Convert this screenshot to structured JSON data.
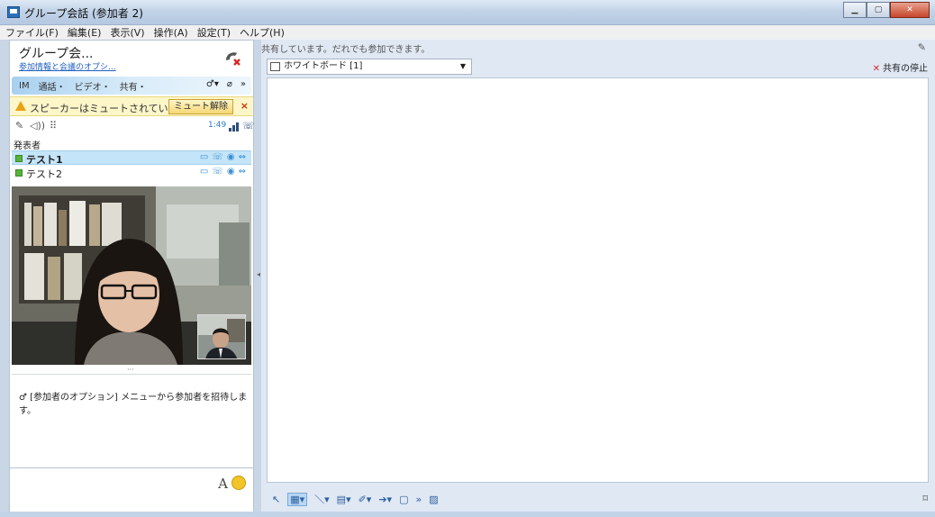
{
  "window": {
    "title": "グループ会話 (参加者 2)"
  },
  "menu": [
    "ファイル(F)",
    "編集(E)",
    "表示(V)",
    "操作(A)",
    "設定(T)",
    "ヘルプ(H)"
  ],
  "conversation": {
    "title": "グループ会...",
    "link": "参加情報と会議のオプシ..."
  },
  "modes": [
    "IM",
    "通話・",
    "ビデオ・",
    "共有・"
  ],
  "mute_banner": {
    "text": "スピーカーはミュートされていま...",
    "button": "ミュート解除",
    "close": "×"
  },
  "call": {
    "time": "1:49"
  },
  "participants": {
    "section": "発表者",
    "list": [
      {
        "name": "テスト1",
        "selected": true
      },
      {
        "name": "テスト2",
        "selected": false
      }
    ]
  },
  "notice": "[参加者のオプション] メニューから参加者を招待します。",
  "input": {
    "font_label": "A"
  },
  "share": {
    "status": "共有しています。だれでも参加できます。",
    "whiteboard": "ホワイトボード [1]",
    "stop": "共有の停止"
  },
  "colors": {
    "accent": "#2b7bd0",
    "stop": "#d72a2a",
    "banner": "#fdf6c9"
  }
}
